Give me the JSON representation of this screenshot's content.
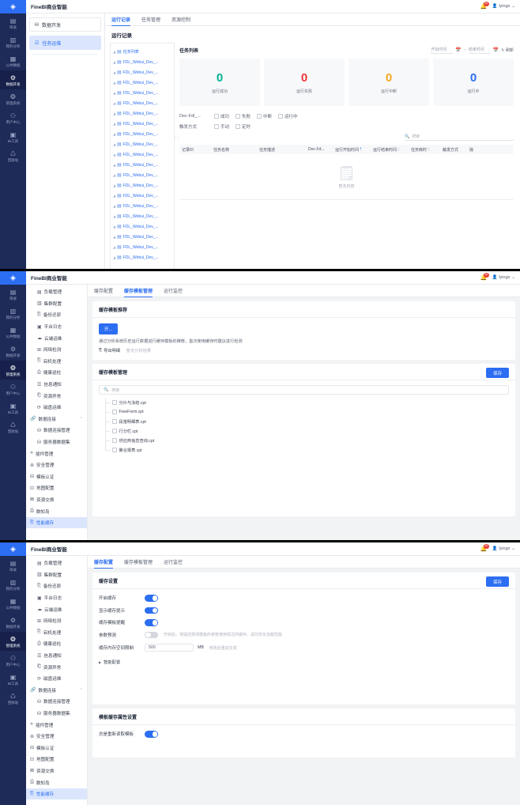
{
  "brand": "FineBI商业智能",
  "topbar": {
    "bell_icon": "bell-icon",
    "badge": "10",
    "user": "lyingx",
    "chevron": "chevron-down-icon"
  },
  "rail": {
    "logo_icon": "finebi-logo-icon",
    "items": [
      {
        "icon": "directory-icon",
        "label": "目录"
      },
      {
        "icon": "chart-icon",
        "label": "我的分析"
      },
      {
        "icon": "database-icon",
        "label": "公共数据"
      },
      {
        "icon": "gear-icon",
        "label": "数据开发"
      },
      {
        "icon": "system-icon",
        "label": "管理系统"
      },
      {
        "icon": "users-icon",
        "label": "用户中心"
      },
      {
        "icon": "toolbox-icon",
        "label": "BI工具"
      },
      {
        "icon": "recycle-icon",
        "label": "回收站"
      }
    ]
  },
  "panel1": {
    "nav": [
      {
        "icon": "dev-icon",
        "label": "数据开发",
        "active": false
      },
      {
        "icon": "task-icon",
        "label": "任务运维",
        "active": true
      }
    ],
    "tabs": [
      {
        "label": "运行记录",
        "active": true
      },
      {
        "label": "任务管理",
        "active": false
      },
      {
        "label": "资源控制",
        "active": false
      }
    ],
    "page_title": "运行记录",
    "tree": [
      "任务列表",
      "FDL_Webui_Dev_...",
      "FDL_Webui_Dev_...",
      "FDL_Webui_Dev_...",
      "FDL_Webui_Dev_...",
      "FDL_Webui_Dev_...",
      "FDL_Webui_Dev_...",
      "FDL_Webui_Dev_...",
      "FDL_Webui_Dev_...",
      "FDL_Webui_Dev_...",
      "FDL_Webui_Dev_...",
      "FDL_Webui_Dev_...",
      "FDL_Webui_Dev_...",
      "FDL_Webui_Dev_...",
      "FDL_Webui_Dev_...",
      "FDL_Webui_Dev_...",
      "FDL_Webui_Dev_...",
      "FDL_Webui_Dev_...",
      "FDL_Webui_Dev_...",
      "FDL_Webui_Dev_...",
      "FDL_Webui_Dev_..."
    ],
    "list_title": "任务列表",
    "date_start_placeholder": "开始时间",
    "date_end_placeholder": "结束时间",
    "date_sep": "~",
    "refresh_label": "刷新",
    "cards": [
      {
        "value": "0",
        "label": "运行成功",
        "color": "#00b396"
      },
      {
        "value": "0",
        "label": "运行失败",
        "color": "#f0353a"
      },
      {
        "value": "0",
        "label": "运行中断",
        "color": "#f5a623"
      },
      {
        "value": "0",
        "label": "运行中",
        "color": "#2c6ef2"
      }
    ],
    "filters": [
      {
        "label": "Dec-Fdl_...",
        "options": [
          "成功",
          "失败",
          "中断",
          "运行中"
        ]
      },
      {
        "label": "触发方式",
        "options": [
          "手动",
          "定时"
        ]
      }
    ],
    "search_placeholder": "搜索",
    "columns": [
      "记录ID",
      "任务名称",
      "任务描述",
      "Dec-Fd...",
      "运行开始时间",
      "运行结束时间",
      "任务耗时",
      "触发方式",
      "操"
    ],
    "empty_label": "暂无内容"
  },
  "admin_nav": [
    {
      "icon": "load-icon",
      "label": "负载管理",
      "level": 1
    },
    {
      "icon": "cluster-icon",
      "label": "集群配置",
      "level": 1
    },
    {
      "icon": "backup-icon",
      "label": "备份还原",
      "level": 1
    },
    {
      "icon": "log-icon",
      "label": "平台日志",
      "level": 1
    },
    {
      "icon": "cloud-icon",
      "label": "云端运维",
      "level": 1
    },
    {
      "icon": "network-icon",
      "label": "网络检测",
      "level": 1
    },
    {
      "icon": "crash-icon",
      "label": "宕机处理",
      "level": 1
    },
    {
      "icon": "health-icon",
      "label": "健康巡检",
      "level": 1
    },
    {
      "icon": "notify-icon",
      "label": "信息通知",
      "level": 1
    },
    {
      "icon": "warning-icon",
      "label": "资源异常",
      "level": 1
    },
    {
      "icon": "disk-icon",
      "label": "磁盘运维",
      "level": 1
    },
    {
      "icon": "link-icon",
      "label": "数据连接",
      "level": 0,
      "caret": "chevron-up-icon"
    },
    {
      "icon": "conn-icon",
      "label": "数据连接管理",
      "level": 1
    },
    {
      "icon": "server-icon",
      "label": "服务器数据集",
      "level": 1
    },
    {
      "icon": "plugin-icon",
      "label": "插件管理",
      "level": 0
    },
    {
      "icon": "shield-icon",
      "label": "安全管理",
      "level": 0
    },
    {
      "icon": "cert-icon",
      "label": "模板认证",
      "level": 0
    },
    {
      "icon": "map-icon",
      "label": "地图配置",
      "level": 0
    },
    {
      "icon": "exchange-icon",
      "label": "资源交换",
      "level": 0
    },
    {
      "icon": "island-icon",
      "label": "数知岛",
      "level": 0
    },
    {
      "icon": "cache-icon",
      "label": "性能缓存",
      "level": 0,
      "active": true
    }
  ],
  "admin_tabs": [
    {
      "label": "缓存配置"
    },
    {
      "label": "缓存模板管理"
    },
    {
      "label": "运行监控"
    }
  ],
  "panel2": {
    "active_tab": "缓存模板管理",
    "recommend_title": "缓存模板推荐",
    "analyze_button": "开...",
    "recommend_desc": "通过分析系统历史运行数据进行缓存模板的推荐，首次使用缓存时建议进行检测",
    "export_link": "导出明细",
    "export_icon": "export-icon",
    "no_result": "暂无分析结果",
    "manage_title": "缓存模板管理",
    "save_button": "保存",
    "search_placeholder": "搜索",
    "templates": [
      "分片与冻结.cpt",
      "FreeForm.cpt",
      "段落明细表.cpt",
      "行分栏.cpt",
      "供应商信息查询.cpt",
      "聚合报表.cpt"
    ]
  },
  "panel3": {
    "active_tab": "缓存配置",
    "settings_title": "缓存设置",
    "save_button": "保存",
    "toggles": [
      {
        "label": "开启缓存",
        "on": true,
        "hint": ""
      },
      {
        "label": "显示缓存提示",
        "on": true,
        "hint": ""
      },
      {
        "label": "缓存模板提醒",
        "on": true,
        "hint": ""
      },
      {
        "label": "参数预测",
        "on": false,
        "hint": "开启后，将提前预测模板的参数使用情况并缓存，请勿优化加载性能"
      }
    ],
    "memory_label": "缓存内存空间限制",
    "memory_value": "500",
    "memory_unit": "MB",
    "memory_hint": "修改后重启生效",
    "advanced_label": "智能配置",
    "tmpl_attr_title": "模板缓存属性设置",
    "always_reload_label": "总是重新读取模板",
    "always_reload_on": true
  }
}
